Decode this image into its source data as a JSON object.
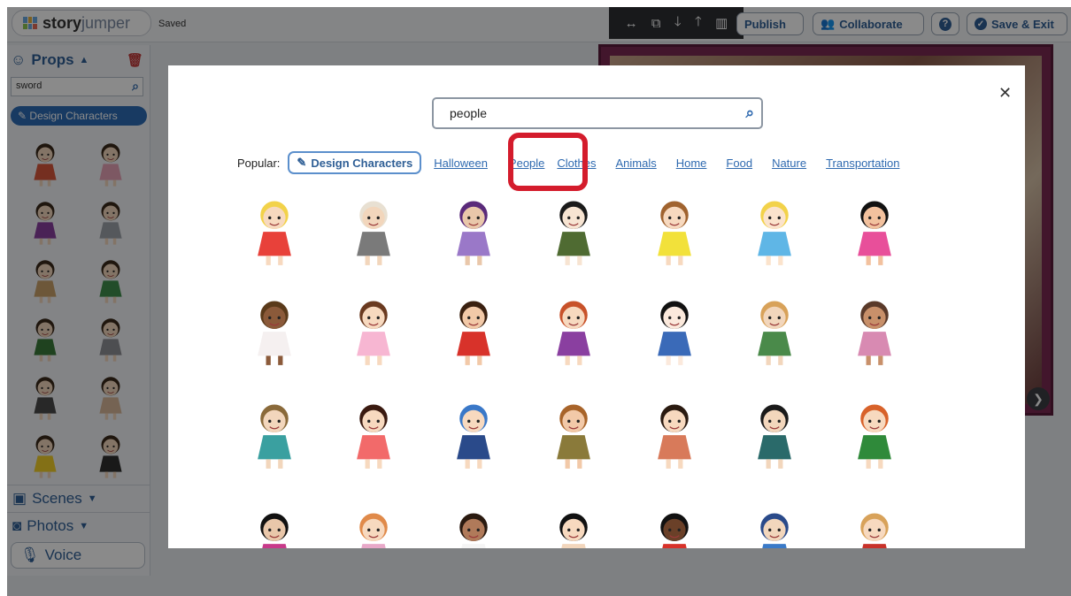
{
  "app": {
    "logo": {
      "text_bold": "story",
      "text_light": "jumper"
    },
    "status": "Saved"
  },
  "toolbar": {
    "image_tools": [
      "swap-icon",
      "copy-icon",
      "arrow-down-icon",
      "arrow-up-icon",
      "trash-icon"
    ],
    "publish": "Publish",
    "collaborate": "Collaborate",
    "help": "?",
    "save_exit": "Save & Exit"
  },
  "sidebar": {
    "props_label": "Props",
    "search_value": "sword",
    "design_characters": "Design Characters",
    "scenes_label": "Scenes",
    "photos_label": "Photos",
    "voice_label": "Voice",
    "prop_thumbs": [
      {
        "name": "boy-red-shirt",
        "color": "#d9573b"
      },
      {
        "name": "girl-pink-dress",
        "color": "#e8a3b8"
      },
      {
        "name": "girl-purple-gown",
        "color": "#8a3fa0"
      },
      {
        "name": "husky-dog",
        "color": "#9ea3ab"
      },
      {
        "name": "labrador-dog",
        "color": "#c9a26a"
      },
      {
        "name": "boy-green-shirt",
        "color": "#3f8f4d"
      },
      {
        "name": "kid-cheering",
        "color": "#3a7a3a"
      },
      {
        "name": "gray-cat",
        "color": "#8e9096"
      },
      {
        "name": "cartoon-eyes",
        "color": "#4a4a4a"
      },
      {
        "name": "face-features",
        "color": "#d8b89a"
      },
      {
        "name": "sun",
        "color": "#f2d02a"
      },
      {
        "name": "waiter-figure",
        "color": "#2f2f2f"
      }
    ]
  },
  "modal": {
    "search_value": "people",
    "popular_label": "Popular:",
    "popular_design": "Design Characters",
    "popular_links": [
      "Halloween",
      "People",
      "Clothes",
      "Animals",
      "Home",
      "Food",
      "Nature",
      "Transportation"
    ],
    "highlighted_link": "People",
    "results": [
      {
        "name": "alice-girl",
        "hair": "#f2d24a",
        "body": "#e8413a",
        "skin": "#f7d9bf"
      },
      {
        "name": "man-gray-vest",
        "hair": "#e8e0d2",
        "body": "#7a7a7a",
        "skin": "#f2d6bc"
      },
      {
        "name": "woman-purple-suit",
        "hair": "#5a2a7a",
        "body": "#9a78c8",
        "skin": "#e9c7aa"
      },
      {
        "name": "girl-black-hair-big",
        "hair": "#1a1a1a",
        "body": "#4f6b32",
        "skin": "#f7e4d2"
      },
      {
        "name": "girl-yellow-dress",
        "hair": "#a0632f",
        "body": "#f2e13a",
        "skin": "#f7d9bf"
      },
      {
        "name": "blonde-blue-dress",
        "hair": "#f2d24a",
        "body": "#5fb6e6",
        "skin": "#fbe3cc"
      },
      {
        "name": "girl-black-bob",
        "hair": "#111111",
        "body": "#e84f9a",
        "skin": "#f2c19e"
      },
      {
        "name": "kid-pink-sweater",
        "hair": "#5a3a1a",
        "body": "#f5f0f0",
        "skin": "#8b5a3a"
      },
      {
        "name": "ballerina-girl",
        "hair": "#6a3a20",
        "body": "#f7b6d2",
        "skin": "#f7d9bf"
      },
      {
        "name": "ice-skater",
        "hair": "#3a2010",
        "body": "#d8322a",
        "skin": "#f2c9a8"
      },
      {
        "name": "girl-red-hair",
        "hair": "#c8522a",
        "body": "#8a3fa0",
        "skin": "#f7d9bf"
      },
      {
        "name": "snow-white",
        "hair": "#111111",
        "body": "#3a6ab8",
        "skin": "#fbe9dc"
      },
      {
        "name": "knight-girl",
        "hair": "#d8a25a",
        "body": "#4a8a4a",
        "skin": "#f2d6bc"
      },
      {
        "name": "bear-girl-pink",
        "hair": "#5a3a2a",
        "body": "#d88ab2",
        "skin": "#c8906a"
      },
      {
        "name": "curly-hair-teal",
        "hair": "#8a6a3a",
        "body": "#3aa0a0",
        "skin": "#f2d6bc"
      },
      {
        "name": "girl-pink-outfit",
        "hair": "#3a1a10",
        "body": "#f26a6a",
        "skin": "#f7d9bf"
      },
      {
        "name": "kid-blue-hood",
        "hair": "#3a78c8",
        "body": "#2a4a8a",
        "skin": "#f7d9bf"
      },
      {
        "name": "ranger-hat",
        "hair": "#a8642a",
        "body": "#8a7a3a",
        "skin": "#f2c9a8"
      },
      {
        "name": "girl-striped-dress",
        "hair": "#2a1a10",
        "body": "#d87a5a",
        "skin": "#f7d9bf"
      },
      {
        "name": "boy-teal-sweater",
        "hair": "#1a1a1a",
        "body": "#2a6a6a",
        "skin": "#f2d6bc"
      },
      {
        "name": "redhead-green-gown",
        "hair": "#d8622a",
        "body": "#2f8a3a",
        "skin": "#f7d9bf"
      },
      {
        "name": "girl-black-curls",
        "hair": "#111111",
        "body": "#c83a8a",
        "skin": "#e9c7aa"
      },
      {
        "name": "girl-ginger-hair",
        "hair": "#e08a4a",
        "body": "#e8a8c8",
        "skin": "#f7d9bf"
      },
      {
        "name": "teacher-desk",
        "hair": "#2a1a10",
        "body": "#f5f5f5",
        "skin": "#b07a5a"
      },
      {
        "name": "girl-bowl-cut",
        "hair": "#111111",
        "body": "#f2d6bc",
        "skin": "#f7d9bf"
      },
      {
        "name": "kid-soccer",
        "hair": "#111111",
        "body": "#d8322a",
        "skin": "#6a4028"
      },
      {
        "name": "kid-blue-cap",
        "hair": "#2a4a8a",
        "body": "#3a7ac8",
        "skin": "#f2d6bc"
      },
      {
        "name": "woman-red-top",
        "hair": "#d8a25a",
        "body": "#c8322a",
        "skin": "#f7d9bf"
      }
    ]
  }
}
